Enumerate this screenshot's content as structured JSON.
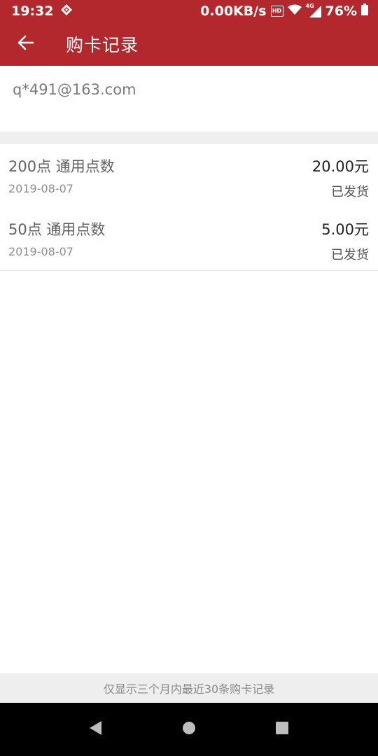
{
  "status_bar": {
    "time": "19:32",
    "net_speed": "0.00KB/s",
    "hd_label": "HD",
    "network_label": "4G",
    "battery": "76%",
    "icons": [
      "notification-icon",
      "hd-icon",
      "wifi-icon",
      "signal-icon",
      "battery-icon"
    ]
  },
  "toolbar": {
    "title": "购卡记录",
    "back_icon": "arrow-left-icon",
    "color": "#b3282d"
  },
  "account": {
    "email": "q*491@163.com"
  },
  "records": [
    {
      "name": "200点 通用点数",
      "date": "2019-08-07",
      "price": "20.00元",
      "status": "已发货"
    },
    {
      "name": "50点 通用点数",
      "date": "2019-08-07",
      "price": "5.00元",
      "status": "已发货"
    }
  ],
  "footer": {
    "note": "仅显示三个月内最近30条购卡记录"
  },
  "nav": {
    "back_icon": "nav-back-icon",
    "home_icon": "nav-home-icon",
    "recents_icon": "nav-recents-icon"
  }
}
